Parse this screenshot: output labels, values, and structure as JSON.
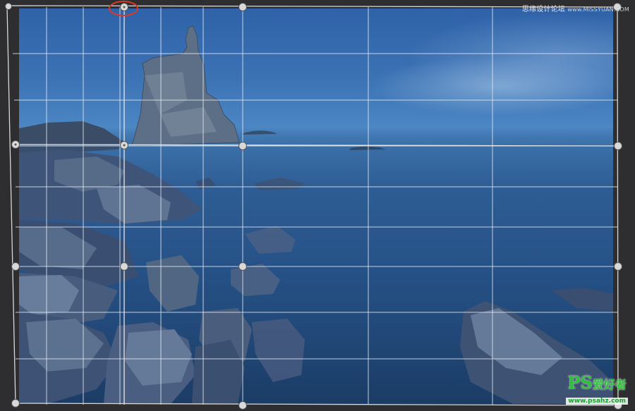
{
  "watermark_top": {
    "text": "思缘设计论坛",
    "site": "www.MISSYUAN.COM"
  },
  "logo": {
    "brand": "PS",
    "tagline": "爱好者",
    "url": "www.psahz.com"
  },
  "colors": {
    "marker": "#d63a2a",
    "frame": "#d8d8d8",
    "background": "#2e2e30"
  },
  "icons": {
    "handle": "circle-handle-icon",
    "pin": "pin-icon"
  }
}
